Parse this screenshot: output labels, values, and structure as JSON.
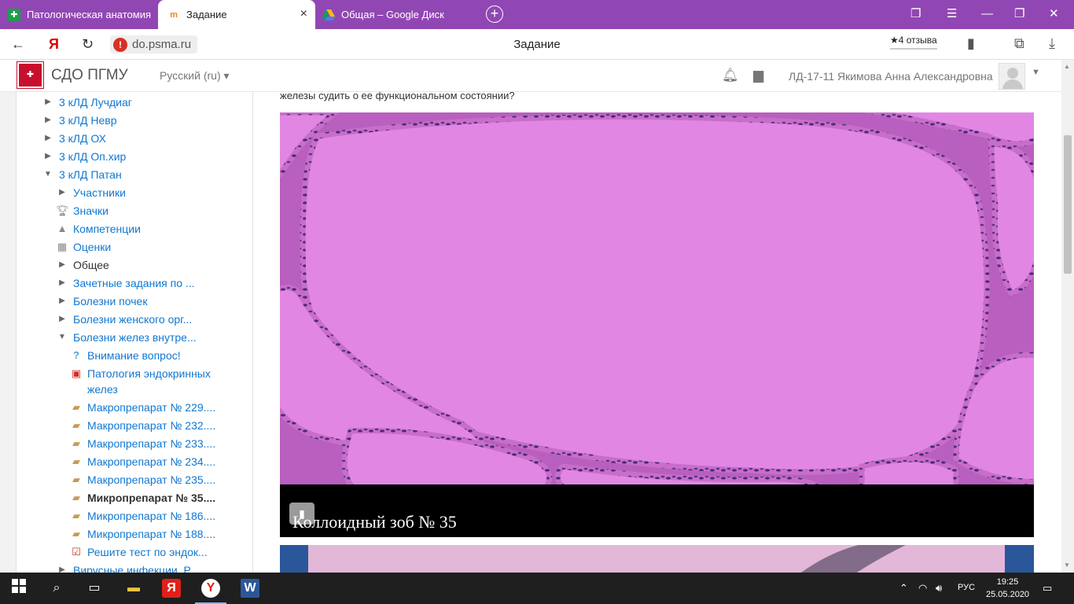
{
  "browser": {
    "tabs": [
      {
        "label": "Патологическая анатомия",
        "favicon": "green-cross"
      },
      {
        "label": "Задание",
        "favicon": "moodle"
      },
      {
        "label": "Общая – Google Диск",
        "favicon": "google-drive"
      }
    ],
    "url": "do.psma.ru",
    "page_title": "Задание",
    "reviews": "★4 отзыва"
  },
  "site": {
    "name": "СДО ПГМУ",
    "language": "Русский (ru)",
    "user": "ЛД-17-11 Якимова Анна Александровна"
  },
  "sidebar": {
    "items": [
      {
        "label": "3 кЛД Лучдиаг",
        "icon": "triangle-right"
      },
      {
        "label": "3 кЛД Невр",
        "icon": "triangle-right"
      },
      {
        "label": "3 кЛД ОХ",
        "icon": "triangle-right"
      },
      {
        "label": "3 кЛД Оп.хир",
        "icon": "triangle-right"
      },
      {
        "label": "3 кЛД Патан",
        "icon": "triangle-down"
      },
      {
        "label": "Участники",
        "icon": "triangle-right"
      },
      {
        "label": "Значки",
        "icon": "trophy-icon"
      },
      {
        "label": "Компетенции",
        "icon": "competency-icon"
      },
      {
        "label": "Оценки",
        "icon": "table-icon"
      },
      {
        "label": "Общее",
        "icon": "triangle-right"
      },
      {
        "label": "Зачетные задания по ...",
        "icon": "triangle-right"
      },
      {
        "label": "Болезни почек",
        "icon": "triangle-right"
      },
      {
        "label": "Болезни женского орг...",
        "icon": "triangle-right"
      },
      {
        "label": "Болезни желез внутре...",
        "icon": "triangle-down"
      },
      {
        "label": "Внимание вопрос!",
        "icon": "question-icon"
      },
      {
        "label": "Патология эндокринных желез",
        "icon": "pdf-icon"
      },
      {
        "label": "Макропрепарат № 229....",
        "icon": "lesson-icon"
      },
      {
        "label": "Макропрепарат № 232....",
        "icon": "lesson-icon"
      },
      {
        "label": "Макропрепарат № 233....",
        "icon": "lesson-icon"
      },
      {
        "label": "Макропрепарат № 234....",
        "icon": "lesson-icon"
      },
      {
        "label": "Макропрепарат № 235....",
        "icon": "lesson-icon"
      },
      {
        "label": "Микропрепарат № 35....",
        "icon": "lesson-icon"
      },
      {
        "label": "Микропрепарат № 186....",
        "icon": "lesson-icon"
      },
      {
        "label": "Микропрепарат № 188....",
        "icon": "lesson-icon"
      },
      {
        "label": "Решите тест по эндок...",
        "icon": "quiz-icon"
      },
      {
        "label": "Вирусные инфекции. Р...",
        "icon": "triangle-right"
      }
    ]
  },
  "content": {
    "question_tail": "железы судить о ее функциональном состоянии?",
    "slide_caption": "Коллоидный зоб № 35"
  },
  "taskbar": {
    "language": "РУС",
    "time": "19:25",
    "date": "25.05.2020"
  },
  "colors": {
    "tabbar": "#9147b3",
    "link": "#1177d1",
    "tissue": "#dd7fdf"
  }
}
